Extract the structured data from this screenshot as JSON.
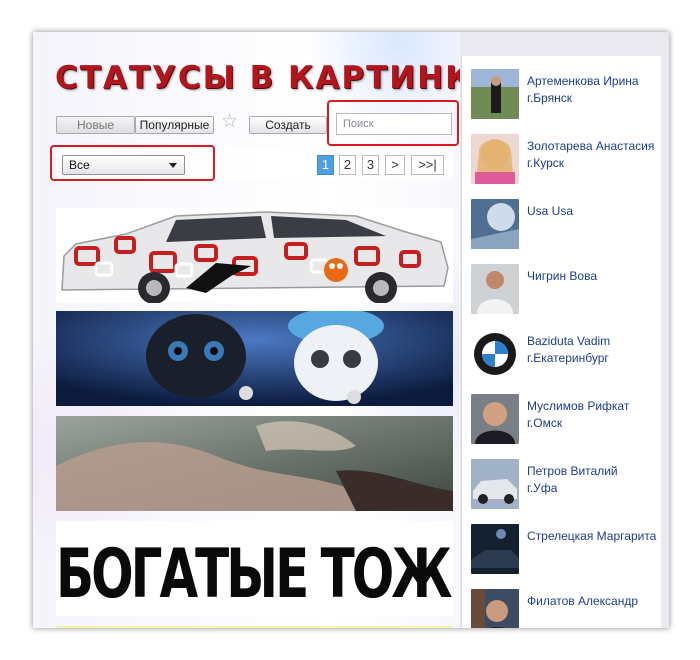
{
  "header": {
    "site_title": "СТАТУСЫ В КАРТИНКАХ"
  },
  "toolbar": {
    "new_label": "Новые",
    "popular_label": "Популярные",
    "create_label": "Создать",
    "search_placeholder": "Поиск"
  },
  "filter": {
    "selected": "Все"
  },
  "pagination": {
    "pages": [
      "1",
      "2",
      "3",
      ">",
      ">>|"
    ],
    "active": "1"
  },
  "banners": {
    "text_banner": "БОГАТЫЕ ТОЖЕ ПЛАЧУТ"
  },
  "sidebar": {
    "users": [
      {
        "name": "Артеменкова Ирина",
        "city": "г.Брянск"
      },
      {
        "name": "Золотарева Анастасия",
        "city": "г.Курск"
      },
      {
        "name": "Usa Usa",
        "city": ""
      },
      {
        "name": "Чигрин Вова",
        "city": ""
      },
      {
        "name": "Baziduta Vadim",
        "city": "г.Екатеринбург"
      },
      {
        "name": "Муслимов Рифкат",
        "city": "г.Омск"
      },
      {
        "name": "Петров Виталий",
        "city": "г.Уфа"
      },
      {
        "name": "Стрелецкая Маргарита",
        "city": ""
      },
      {
        "name": "Филатов Александр",
        "city": ""
      }
    ]
  },
  "colors": {
    "title_red": "#b3151d",
    "highlight_red": "#d61c23",
    "link_blue": "#1c3d8c",
    "active_page": "#4d9fe0"
  }
}
